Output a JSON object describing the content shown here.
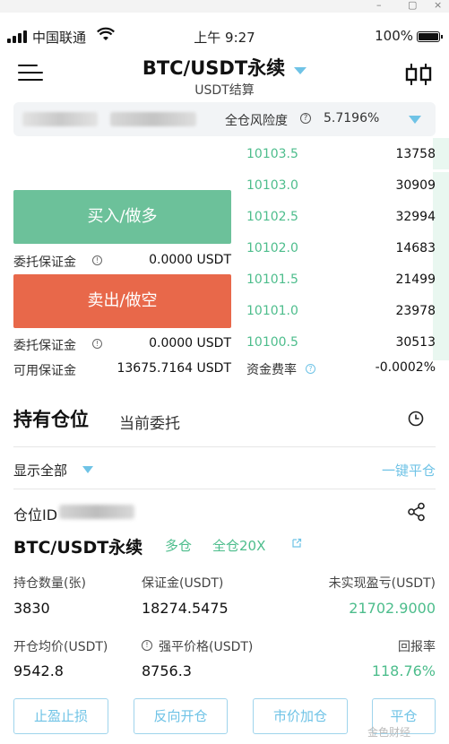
{
  "status_bar": {
    "carrier": "中国联通",
    "time": "上午 9:27",
    "battery": "100%"
  },
  "header": {
    "title": "BTC/USDT永续",
    "subtitle": "USDT结算"
  },
  "risk_bar": {
    "label": "全仓风险度",
    "value": "5.7196%"
  },
  "trade": {
    "buy_label": "买入/做多",
    "sell_label": "卖出/做空",
    "buy_margin_label": "委托保证金",
    "buy_margin_value": "0.0000 USDT",
    "sell_margin_label": "委托保证金",
    "sell_margin_value": "0.0000 USDT",
    "available_label": "可用保证金",
    "available_value": "13675.7164 USDT"
  },
  "order_book": {
    "rows": [
      {
        "price": "10103.5",
        "qty": "13758"
      },
      {
        "price": "10103.0",
        "qty": "30909"
      },
      {
        "price": "10102.5",
        "qty": "32994"
      },
      {
        "price": "10102.0",
        "qty": "14683"
      },
      {
        "price": "10101.5",
        "qty": "21499"
      },
      {
        "price": "10101.0",
        "qty": "23978"
      },
      {
        "price": "10100.5",
        "qty": "30513"
      }
    ],
    "funding_label": "资金费率",
    "funding_value": "-0.0002%"
  },
  "tabs": {
    "positions": "持有仓位",
    "orders": "当前委托"
  },
  "filter": {
    "show_all": "显示全部",
    "close_all": "一键平仓"
  },
  "position": {
    "id_label": "仓位ID",
    "pair": "BTC/USDT永续",
    "side": "多仓",
    "mode": "全仓20X",
    "qty_label": "持仓数量(张)",
    "qty_value": "3830",
    "margin_label": "保证金(USDT)",
    "margin_value": "18274.5475",
    "pnl_label": "未实现盈亏(USDT)",
    "pnl_value": "21702.9000",
    "entry_label": "开仓均价(USDT)",
    "entry_value": "9542.8",
    "liq_label": "强平价格(USDT)",
    "liq_value": "8756.3",
    "roe_label": "回报率",
    "roe_value": "118.76%"
  },
  "actions": {
    "tp_sl": "止盈止损",
    "reverse": "反向开仓",
    "market_add": "市价加仓",
    "close": "平仓"
  },
  "watermark": "金色财经",
  "colors": {
    "buy": "#6cc19a",
    "sell": "#e8684a",
    "accent": "#6fc3e6",
    "price_green": "#4dbd8c"
  }
}
